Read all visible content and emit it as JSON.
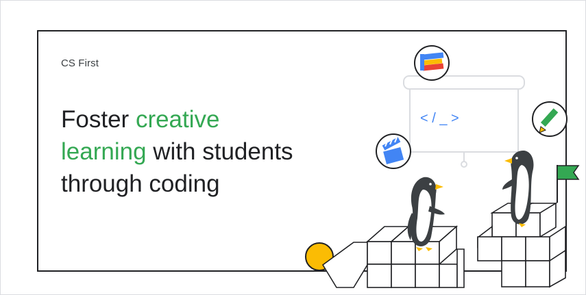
{
  "brand": {
    "label": "CS First"
  },
  "headline": {
    "part1": "Foster",
    "highlight1": "creative",
    "highlight2": "learning",
    "part2": "with students",
    "part3": "through coding"
  },
  "board": {
    "code_text": "< / _ >"
  },
  "colors": {
    "accent_green": "#34a853",
    "text_dark": "#202124",
    "code_blue": "#4285f4",
    "yellow": "#fbbc04",
    "red": "#ea4335",
    "flag_green": "#34a853"
  },
  "icons": [
    "blocks-icon",
    "code-board-icon",
    "pencil-icon",
    "clapperboard-icon",
    "flag-icon"
  ]
}
